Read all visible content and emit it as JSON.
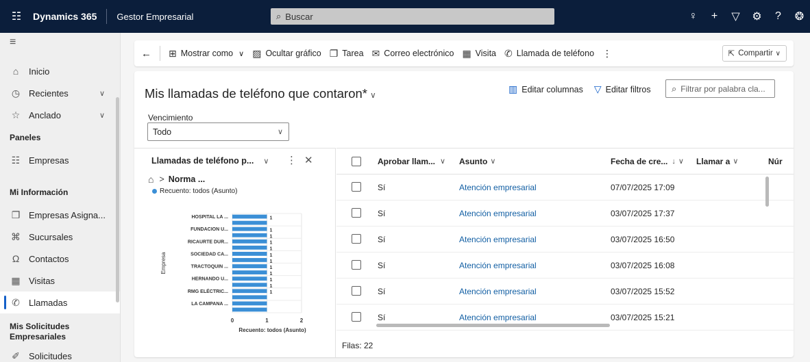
{
  "topbar": {
    "brand": "Dynamics 365",
    "app_name": "Gestor Empresarial",
    "search_placeholder": "Buscar",
    "icons": [
      "lightbulb-icon",
      "plus-icon",
      "filter-icon",
      "gear-icon",
      "help-icon",
      "copilot-icon"
    ]
  },
  "nav": {
    "items": [
      {
        "label": "Inicio",
        "icon": "home-icon"
      },
      {
        "label": "Recientes",
        "icon": "clock-icon"
      },
      {
        "label": "Anclado",
        "icon": "pin-icon"
      }
    ],
    "section_paneles": "Paneles",
    "paneles": [
      {
        "label": "Empresas",
        "icon": "building-icon"
      }
    ],
    "section_mi_info": "Mi Información",
    "mi_info": [
      {
        "label": "Empresas Asigna...",
        "icon": "document-icon"
      },
      {
        "label": "Sucursales",
        "icon": "branch-icon"
      },
      {
        "label": "Contactos",
        "icon": "person-icon"
      },
      {
        "label": "Visitas",
        "icon": "calendar-icon"
      },
      {
        "label": "Llamadas",
        "icon": "phone-icon"
      }
    ],
    "section_solicitudes": "Mis Solicitudes Empresariales",
    "solicitudes": [
      {
        "label": "Solicitudes",
        "icon": "paperclip-icon"
      }
    ]
  },
  "commandbar": {
    "show_as": "Mostrar como",
    "hide_chart": "Ocultar gráfico",
    "task": "Tarea",
    "email": "Correo electrónico",
    "visit": "Visita",
    "phone_call": "Llamada de teléfono",
    "share": "Compartir"
  },
  "view": {
    "title": "Mis llamadas de teléfono que contaron*",
    "edit_columns": "Editar columnas",
    "edit_filters": "Editar filtros",
    "filter_placeholder": "Filtrar por palabra cla...",
    "due_label": "Vencimiento",
    "due_value": "Todo"
  },
  "chart_pane": {
    "title": "Llamadas de teléfono p...",
    "breadcrumb": "Norma ...",
    "legend": "Recuento: todos (Asunto)"
  },
  "chart_data": {
    "type": "bar",
    "orientation": "horizontal",
    "categories": [
      "HOSPITAL LA ...",
      "",
      "FUNDACION U...",
      "",
      "RICAURTE DUR...",
      "",
      "SOCIEDAD CA...",
      "",
      "TRACTOQUIN ...",
      "",
      "HERNANDO U...",
      "",
      "RMG ELÉCTRIC...",
      "",
      "LA CAMPANA ...",
      ""
    ],
    "values": [
      1,
      1,
      1,
      1,
      1,
      1,
      1,
      1,
      1,
      1,
      1,
      1,
      1,
      1,
      1,
      1
    ],
    "data_labels": [
      "1",
      "",
      "1",
      "1",
      "1",
      "1",
      "1",
      "1",
      "1",
      "1",
      "1",
      "1",
      "1",
      "",
      "",
      ""
    ],
    "xlabel": "Recuento: todos (Asunto)",
    "ylabel": "Empresa",
    "xlim": [
      0,
      2
    ],
    "xticks": [
      "0",
      "1",
      "2"
    ],
    "series_color": "#3b8fd6",
    "grid": true
  },
  "grid": {
    "columns": [
      "Aprobar llam...",
      "Asunto",
      "Fecha de cre...",
      "Llamar a",
      "Núr"
    ],
    "rows": [
      {
        "approve": "Sí",
        "subject": "Atención empresarial",
        "created": "07/07/2025 17:09"
      },
      {
        "approve": "Sí",
        "subject": "Atención empresarial",
        "created": "03/07/2025 17:37"
      },
      {
        "approve": "Sí",
        "subject": "Atención empresarial",
        "created": "03/07/2025 16:50"
      },
      {
        "approve": "Sí",
        "subject": "Atención empresarial",
        "created": "03/07/2025 16:08"
      },
      {
        "approve": "Sí",
        "subject": "Atención empresarial",
        "created": "03/07/2025 15:52"
      },
      {
        "approve": "Sí",
        "subject": "Atención empresarial",
        "created": "03/07/2025 15:21"
      }
    ],
    "row_count": "Filas: 22"
  },
  "colors": {
    "topbar": "#0b1e3b",
    "accent": "#1460c8",
    "link": "#115ea3",
    "bar": "#3b8fd6"
  }
}
